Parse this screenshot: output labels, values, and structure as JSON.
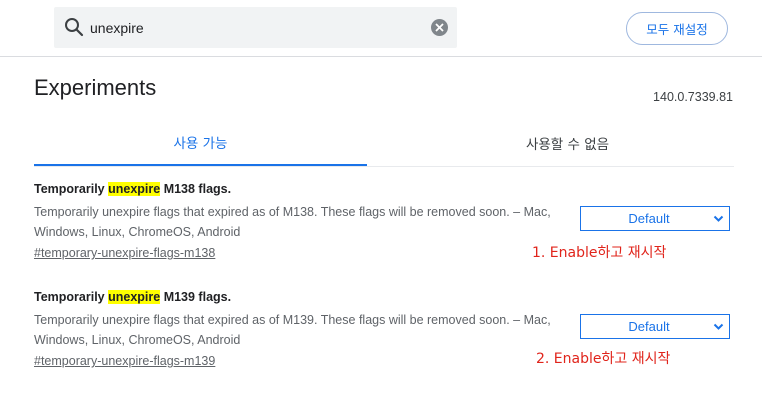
{
  "header": {
    "search": {
      "value": "unexpire",
      "placeholder": ""
    },
    "reset_button_label": "모두 재설정"
  },
  "page": {
    "title": "Experiments",
    "version": "140.0.7339.81"
  },
  "tabs": [
    {
      "label": "사용 가능",
      "active": true
    },
    {
      "label": "사용할 수 없음",
      "active": false
    }
  ],
  "experiments": [
    {
      "title_prefix": "Temporarily ",
      "title_highlight": "unexpire",
      "title_suffix": " M138 flags.",
      "description": "Temporarily unexpire flags that expired as of M138. These flags will be removed soon. – Mac, Windows, Linux, ChromeOS, Android",
      "link": "#temporary-unexpire-flags-m138",
      "selected": "Default",
      "annotation": "1. Enable하고 재시작"
    },
    {
      "title_prefix": "Temporarily ",
      "title_highlight": "unexpire",
      "title_suffix": " M139 flags.",
      "description": "Temporarily unexpire flags that expired as of M139. These flags will be removed soon. – Mac, Windows, Linux, ChromeOS, Android",
      "link": "#temporary-unexpire-flags-m139",
      "selected": "Default",
      "annotation": "2. Enable하고 재시작"
    }
  ],
  "colors": {
    "accent": "#1a73e8",
    "highlight": "#ffff00",
    "annotation": "#e0241b"
  },
  "icons": [
    "search-icon",
    "clear-icon",
    "chevron-down-icon"
  ]
}
